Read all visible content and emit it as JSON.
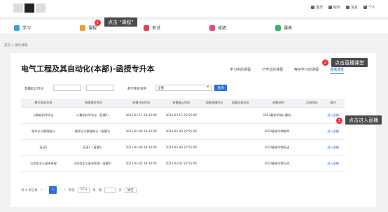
{
  "topbar": {
    "nav": [
      {
        "icon": "home-icon",
        "label": "首页"
      },
      {
        "icon": "wallet-icon",
        "label": "财务"
      },
      {
        "icon": "bell-icon",
        "label": "消息"
      },
      {
        "icon": "user-icon",
        "label": "个人"
      }
    ]
  },
  "navbar": {
    "items": [
      {
        "label": "学习",
        "color": "#2ba8e0"
      },
      {
        "label": "课程",
        "color": "#f39a2b"
      },
      {
        "label": "考试",
        "color": "#e2434b"
      },
      {
        "label": "成绩",
        "color": "#e8467c"
      },
      {
        "label": "课表",
        "color": "#3bb36b"
      }
    ]
  },
  "callouts": {
    "c1": {
      "num": "1",
      "text": "点击 \"课程\""
    },
    "c2": {
      "num": "2",
      "text": "点击直播课堂"
    },
    "c3": {
      "num": "3",
      "text": "点击进入直播"
    }
  },
  "breadcrumb": "首页 > 我的课程",
  "course": {
    "title": "电气工程及其自动化(本部)-函授专升本",
    "tabs": [
      "学习中的课程",
      "已学过的课程",
      "等待学习的课程",
      "直播课堂"
    ],
    "active_tab": 3
  },
  "filter": {
    "time_label": "直播起止时间",
    "teaching_label": "教学版本名称",
    "teaching_value": "全部",
    "query_button": "查询"
  },
  "table": {
    "headers": [
      "教学版本名称",
      "直播课堂名称",
      "直播开始时间",
      "直播截止时间",
      "观看直播时长",
      "观看回放时长",
      "直播说明",
      "回放地址",
      "操作"
    ],
    "rows": [
      [
        "计算机科学导论",
        "计算机科学导论（直播1）",
        "2023-03-13 18:30:00",
        "2023-03-13 20:55:00",
        "",
        "",
        "2023春季学期计算机...",
        "",
        "进入直播"
      ],
      [
        "概率论与数理统计",
        "概率论与数理统计（直播1）",
        "2023-03-09 18:30:00",
        "2023-03-09 20:55:00",
        "",
        "",
        "2023春季学期概率...",
        "",
        "进入直播"
      ],
      [
        "英语1",
        "英语1（直播1）",
        "2023-03-08 18:30:00",
        "2023-03-09 20:55:00",
        "",
        "",
        "2023春季学期英语...",
        "",
        "进入直播"
      ],
      [
        "马克思主义基本原理",
        "马克思主义基本原理（直播1）",
        "2023-03-02 18:30:00",
        "2023-03-02 20:55:00",
        "",
        "",
        "2023春季学期马克...",
        "",
        "进入直播"
      ]
    ]
  },
  "pager": {
    "total": "共 4 条信息",
    "first": "«",
    "prev": "‹",
    "page": "1",
    "next": "›",
    "last": "»",
    "per_page_label": "每页",
    "per_page": "50",
    "unit": "条",
    "goto_label": "第",
    "goto_unit": "页",
    "confirm": "确定"
  }
}
